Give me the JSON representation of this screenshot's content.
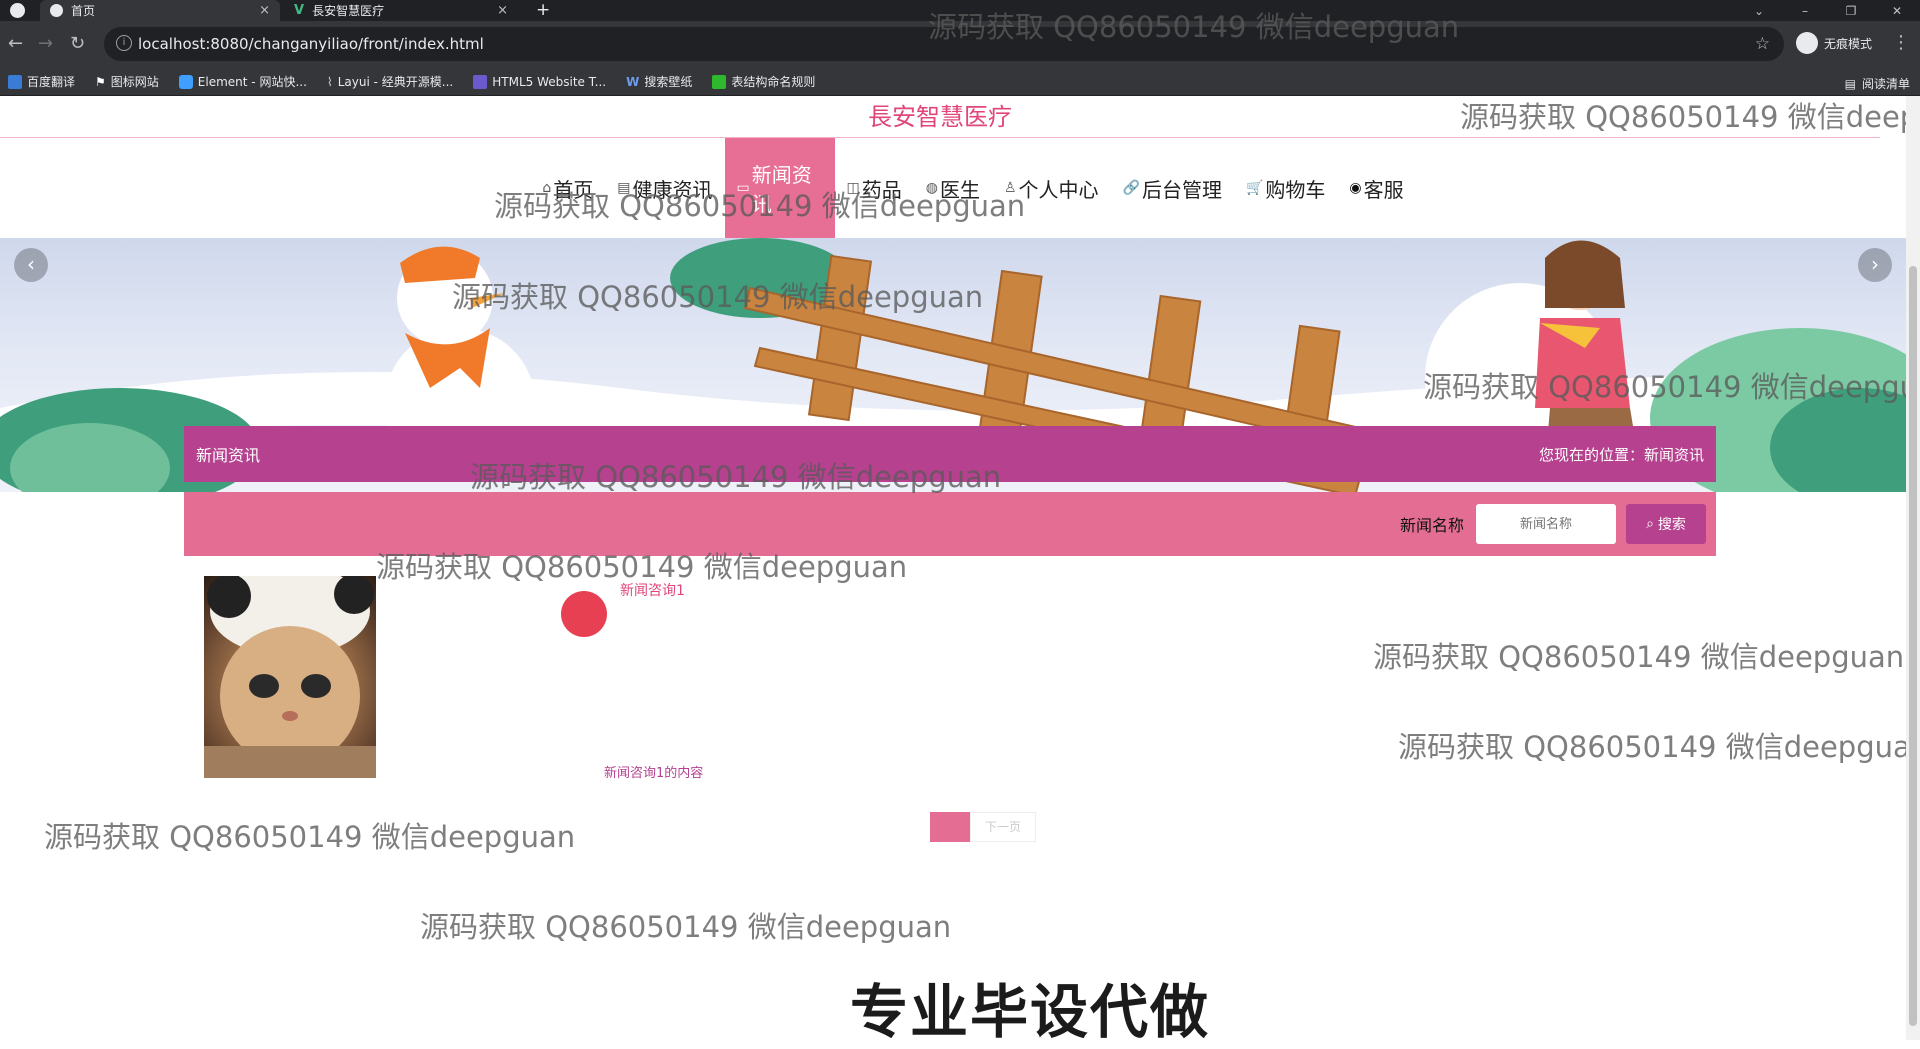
{
  "browser": {
    "tabs": [
      {
        "title": "首页",
        "close": "×",
        "active": true
      },
      {
        "title": "長安智慧医疗",
        "close": "×",
        "active": false
      }
    ],
    "new_tab": "+",
    "url": "localhost:8080/changanyiliao/front/index.html",
    "profile_label": "无痕模式",
    "window_controls": [
      "⌄",
      "–",
      "❐",
      "✕"
    ],
    "bookmarks": [
      {
        "label": "百度翻译",
        "color": "#3a7bd5"
      },
      {
        "label": "图标网站",
        "color": "#ffffff"
      },
      {
        "label": "Element - 网站快...",
        "color": "#409eff"
      },
      {
        "label": "Layui - 经典开源模...",
        "color": "#cccccc"
      },
      {
        "label": "HTML5 Website T...",
        "color": "#6a5acd"
      },
      {
        "label": "搜索壁纸",
        "color": "#4a7bd0"
      },
      {
        "label": "表结构命名规则",
        "color": "#2eb82e"
      }
    ],
    "reading_list": "阅读清单"
  },
  "site": {
    "title": "長安智慧医疗",
    "nav": [
      {
        "icon": "⌂",
        "label": "首页"
      },
      {
        "icon": "▤",
        "label": "健康资讯"
      },
      {
        "icon": "▭",
        "label": "新闻资讯",
        "active": true
      },
      {
        "icon": "◫",
        "label": "药品"
      },
      {
        "icon": "◍",
        "label": "医生"
      },
      {
        "icon": "♙",
        "label": "个人中心"
      },
      {
        "icon": "🔗",
        "label": "后台管理"
      },
      {
        "icon": "🛒",
        "label": "购物车"
      },
      {
        "icon": "◉",
        "label": "客服"
      }
    ],
    "banner_prev": "‹",
    "banner_next": "›"
  },
  "section": {
    "title": "新闻资讯",
    "location_label": "您现在的位置：新闻资讯"
  },
  "search": {
    "label": "新闻名称",
    "placeholder": "新闻名称",
    "button": "搜索"
  },
  "news": [
    {
      "title": "新闻咨询1",
      "content": "新闻咨询1的内容"
    }
  ],
  "pager": {
    "next": "下一页"
  },
  "watermark": "源码获取 QQ86050149 微信deepguan",
  "caption": "专业毕设代做",
  "colors": {
    "accent": "#e46d93",
    "purple": "#b5418f",
    "title_pink": "#e0457b"
  }
}
